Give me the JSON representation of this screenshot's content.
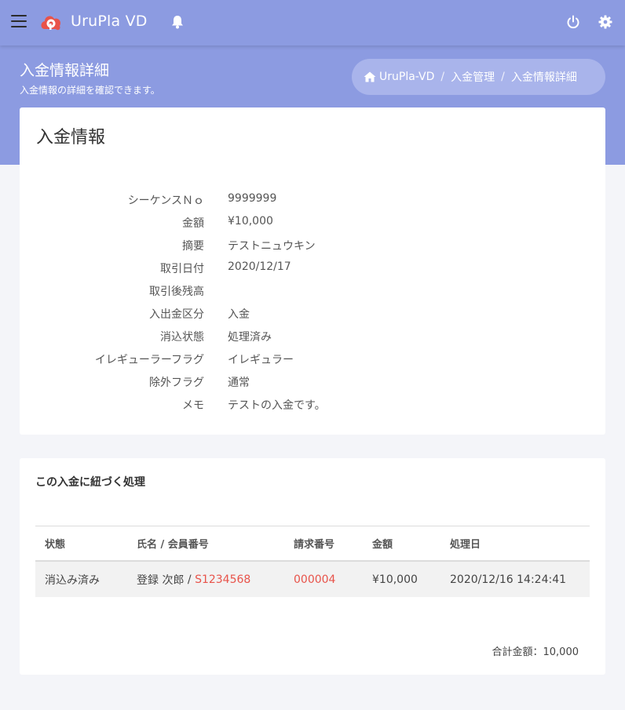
{
  "app": {
    "title": "UruPla VD"
  },
  "header": {
    "page_title": "入金情報詳細",
    "page_subtitle": "入金情報の詳細を確認できます。"
  },
  "breadcrumb": {
    "items": [
      "UruPla-VD",
      "入金管理",
      "入金情報詳細"
    ]
  },
  "detail_card": {
    "title": "入金情報",
    "fields": [
      {
        "label": "シーケンスＮｏ",
        "value": "9999999"
      },
      {
        "label": "金額",
        "value": "¥10,000"
      },
      {
        "label": "摘要",
        "value": "テストニュウキン"
      },
      {
        "label": "取引日付",
        "value": "2020/12/17"
      },
      {
        "label": "取引後残高",
        "value": ""
      },
      {
        "label": "入出金区分",
        "value": "入金"
      },
      {
        "label": "消込状態",
        "value": "処理済み"
      },
      {
        "label": "イレギューラーフラグ",
        "value": "イレギュラー"
      },
      {
        "label": "除外フラグ",
        "value": "通常"
      },
      {
        "label": "メモ",
        "value": "テストの入金です。"
      }
    ]
  },
  "process_card": {
    "title": "この入金に紐づく処理",
    "columns": [
      "状態",
      "氏名 / 会員番号",
      "請求番号",
      "金額",
      "処理日"
    ],
    "rows": [
      {
        "status": "消込み済み",
        "name": "登録 次郎",
        "name_sep": " / ",
        "member_no": "S1234568",
        "invoice_no": "000004",
        "amount": "¥10,000",
        "date": "2020/12/16 14:24:41"
      }
    ],
    "total": "合計金額：10,000"
  },
  "colors": {
    "primary": "#8c9be1",
    "breadcrumb_bg": "#a9b4eb",
    "link": "#e8534a",
    "logo": "#e8534a"
  }
}
